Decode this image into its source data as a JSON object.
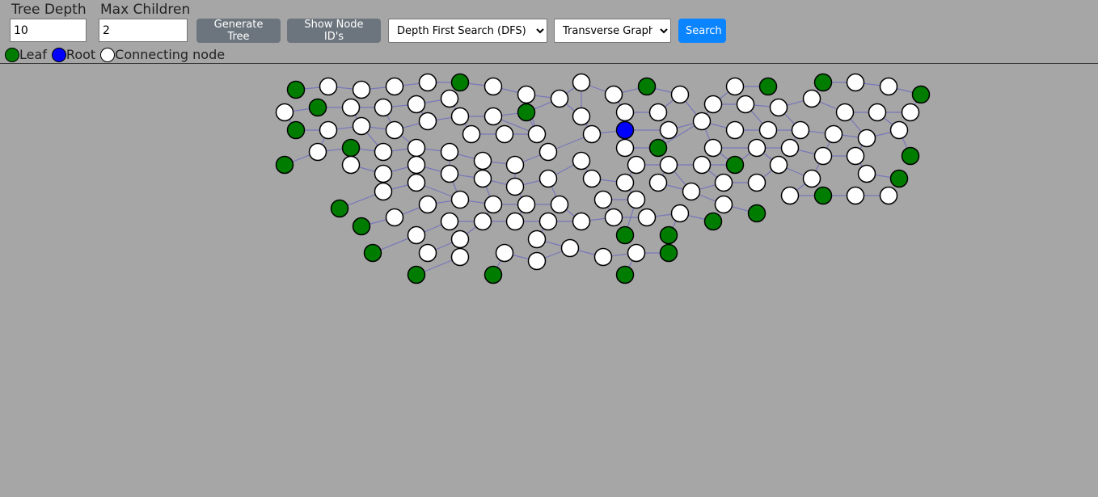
{
  "controls": {
    "tree_depth_label": "Tree Depth",
    "tree_depth_value": "10",
    "max_children_label": "Max Children",
    "max_children_value": "2",
    "generate_label": "Generate Tree",
    "show_ids_label": "Show Node ID's",
    "algorithm_selected": "Depth First Search (DFS)",
    "mode_selected": "Transverse Graph",
    "search_label": "Search"
  },
  "legend": {
    "leaf_label": "Leaf",
    "root_label": "Root",
    "connecting_label": "Connecting node"
  },
  "colors": {
    "leaf": "#007d00",
    "root": "#0000ff",
    "connecting": "#ffffff",
    "edge": "#7777bb",
    "background": "#a6a6a6"
  },
  "icons": {
    "select_arrow": "chevron-down-icon"
  }
}
